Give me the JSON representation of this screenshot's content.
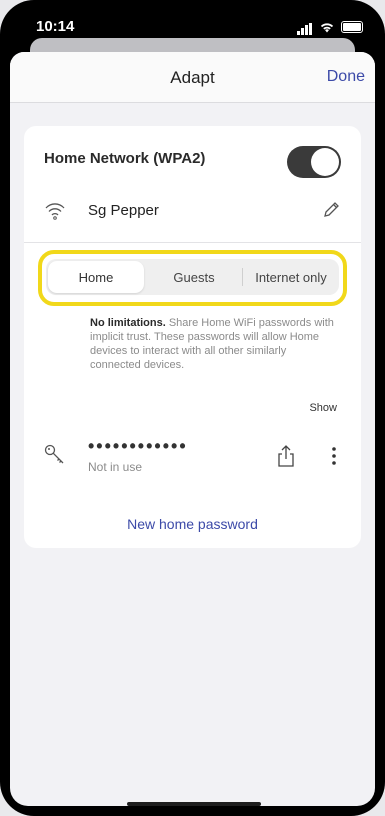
{
  "status": {
    "time": "10:14"
  },
  "nav": {
    "title": "Adapt",
    "done_label": "Done"
  },
  "network": {
    "label": "Home Network (WPA2)",
    "toggle_on": true,
    "wifi_icon": "wifi-icon",
    "name": "Sg Pepper",
    "edit_icon": "pencil-icon"
  },
  "segments": {
    "items": [
      "Home",
      "Guests",
      "Internet only"
    ],
    "active_index": 0,
    "highlight_color": "#f1d81a"
  },
  "description": {
    "title": "No limitations.",
    "body": "Share Home WiFi passwords with implicit trust. These passwords will allow Home devices to interact with all other similarly connected devices."
  },
  "show_label": "Show",
  "password": {
    "dots": "••••••••••••",
    "status": "Not in use",
    "key_icon": "key-icon",
    "share_icon": "share-icon",
    "more_icon": "more-vertical-icon"
  },
  "new_password_label": "New home password",
  "colors": {
    "accent": "#3c4aa8",
    "toggle": "#3a3a3a"
  }
}
